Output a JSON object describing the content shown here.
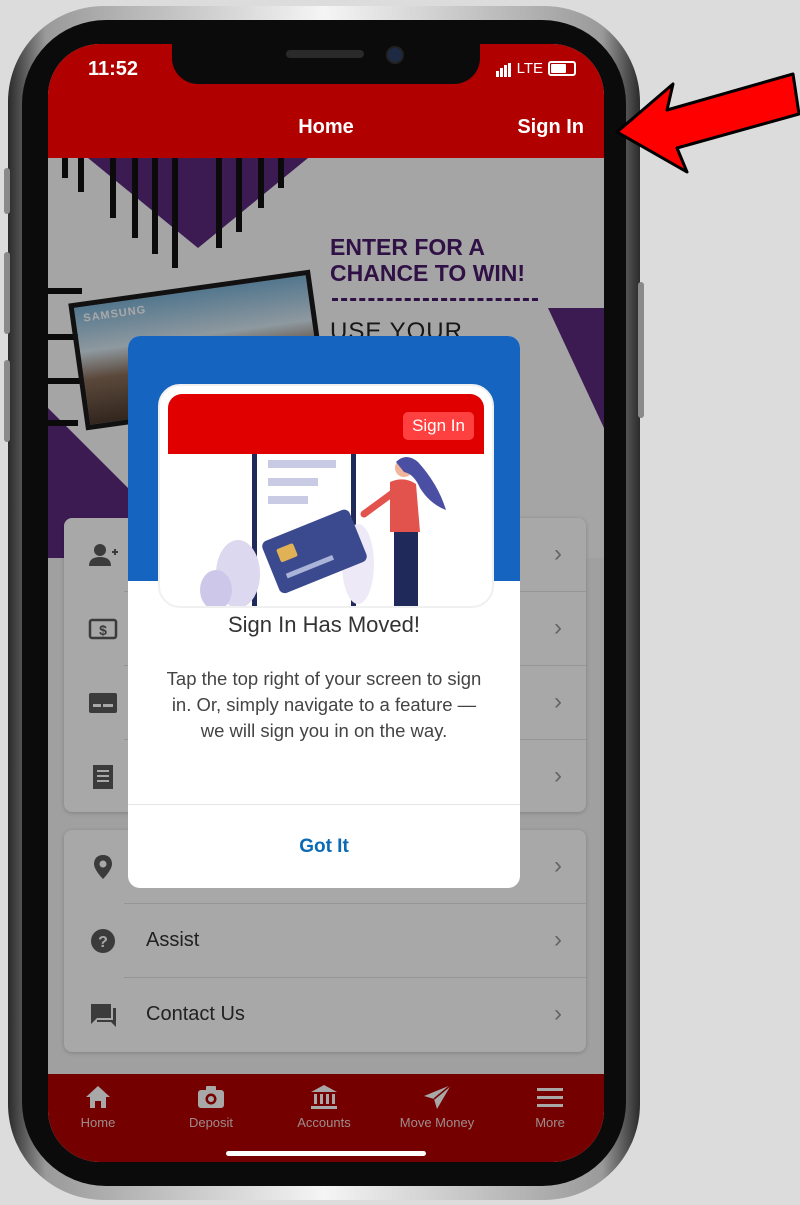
{
  "status_bar": {
    "time": "11:52",
    "network": "LTE"
  },
  "header": {
    "title": "Home",
    "sign_in": "Sign In"
  },
  "banner": {
    "heading_line1": "ENTER FOR A",
    "heading_line2": "CHANCE TO WIN!",
    "subtext": "USE YOUR",
    "tv_brand": "SAMSUNG"
  },
  "list": {
    "assist": "Assist",
    "contact_us": "Contact Us"
  },
  "tabbar": {
    "home": "Home",
    "deposit": "Deposit",
    "accounts": "Accounts",
    "move_money": "Move Money",
    "more": "More"
  },
  "modal": {
    "illustration_sign_in": "Sign In",
    "title": "Sign In Has Moved!",
    "body": "Tap the top right of your screen to sign in. Or, simply navigate to a feature — we will sign you in on the way.",
    "button": "Got It"
  },
  "colors": {
    "brand_red": "#b00000",
    "modal_blue": "#1565c0",
    "link_blue": "#0a6ab5",
    "banner_purple": "#4a1a6b",
    "annotation_arrow": "#ff0000"
  }
}
